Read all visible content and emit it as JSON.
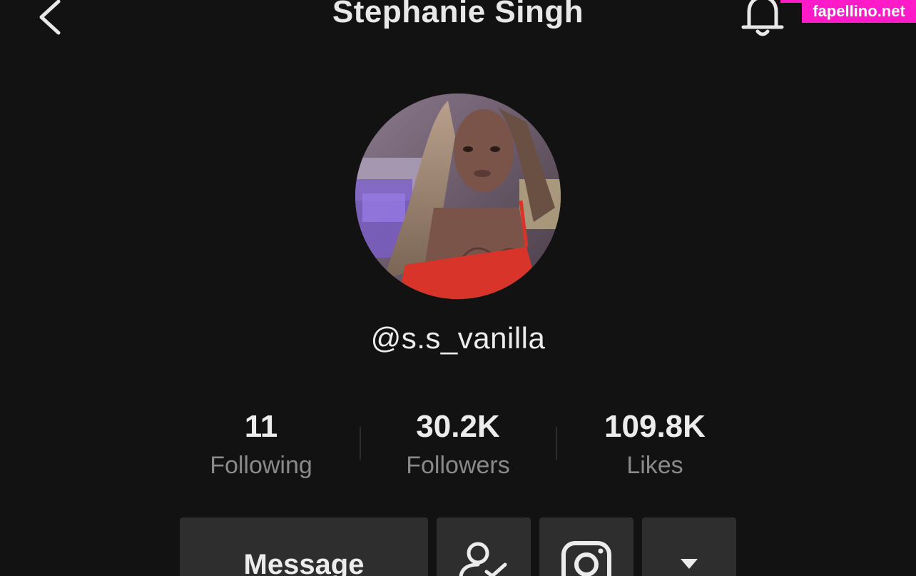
{
  "header": {
    "title": "Stephanie Singh",
    "back_icon": "chevron-left-icon",
    "bell_icon": "bell-icon"
  },
  "watermark": {
    "text": "fapellino.net",
    "color": "#ff1cc8"
  },
  "profile": {
    "handle": "@s.s_vanilla"
  },
  "stats": [
    {
      "value": "11",
      "label": "Following"
    },
    {
      "value": "30.2K",
      "label": "Followers"
    },
    {
      "value": "109.8K",
      "label": "Likes"
    }
  ],
  "actions": {
    "message_label": "Message",
    "friend_icon": "add-friend-icon",
    "instagram_icon": "instagram-icon",
    "more_icon": "caret-down-icon"
  },
  "colors": {
    "background": "#121212",
    "button": "#2e2e2e",
    "secondary_text": "#8a8a8a"
  }
}
